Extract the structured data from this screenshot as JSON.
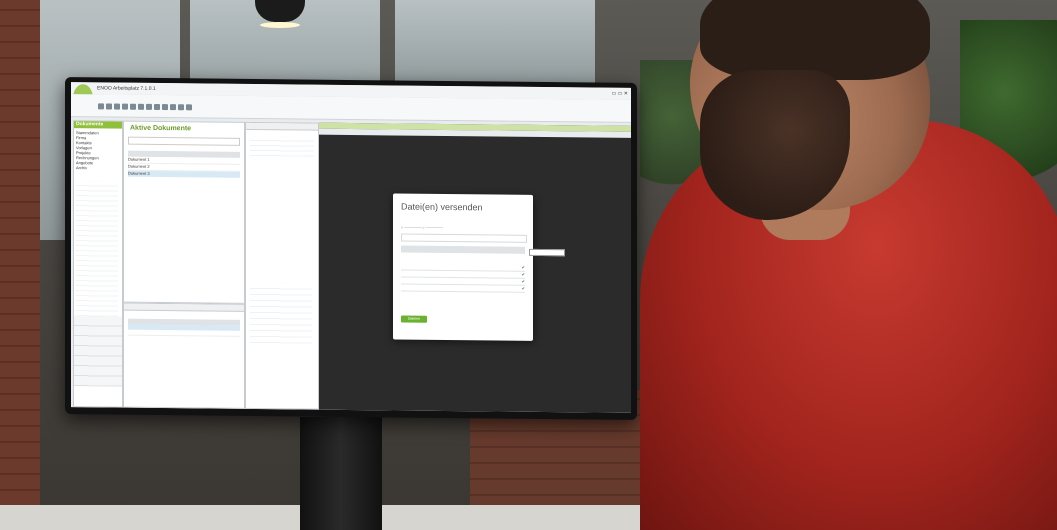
{
  "app": {
    "title": "ENOO Arbeitsplatz 7.1.0.1"
  },
  "left_panel": {
    "header": "Dokumente",
    "items": [
      "Stammdaten",
      "Firma",
      "Kontakte",
      "Vorlagen",
      "Projekte",
      "Rechnungen",
      "Angebote",
      "Archiv"
    ]
  },
  "middle_panel": {
    "header": "Aktive Dokumente",
    "rows": [
      "Dokument 1",
      "Dokument 2",
      "Dokument 3"
    ]
  },
  "dialog": {
    "title": "Datei(en) versenden",
    "submit": "Dateien versenden"
  },
  "colors": {
    "accent": "#8fbf3b",
    "shirt": "#b3281f"
  }
}
